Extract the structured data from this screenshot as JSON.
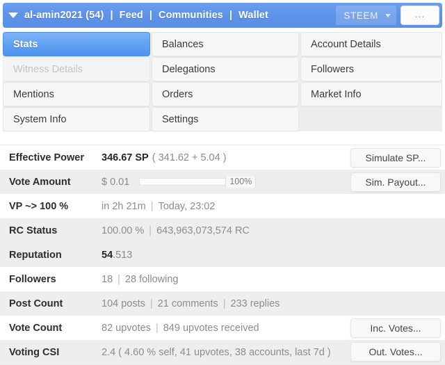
{
  "header": {
    "caret_icon": "caret-down-icon",
    "username": "al-amin2021 (54)",
    "links": [
      {
        "label": "Feed"
      },
      {
        "label": "Communities"
      },
      {
        "label": "Wallet"
      }
    ],
    "separator": "|",
    "token_selector": {
      "label": "STEEM",
      "caret_icon": "caret-down-icon"
    },
    "more_button": "...",
    "accent_color": "#5d92e8"
  },
  "tabs": [
    {
      "label": "Stats",
      "state": "active"
    },
    {
      "label": "Balances",
      "state": "normal"
    },
    {
      "label": "Account Details",
      "state": "normal"
    },
    {
      "label": "Witness Details",
      "state": "disabled"
    },
    {
      "label": "Delegations",
      "state": "normal"
    },
    {
      "label": "Followers",
      "state": "normal"
    },
    {
      "label": "Mentions",
      "state": "normal"
    },
    {
      "label": "Orders",
      "state": "normal"
    },
    {
      "label": "Market Info",
      "state": "normal"
    },
    {
      "label": "System Info",
      "state": "normal"
    },
    {
      "label": "Settings",
      "state": "normal"
    },
    {
      "label": "",
      "state": "empty"
    }
  ],
  "stats": {
    "effective_power": {
      "label": "Effective Power",
      "value_strong": "346.67 SP",
      "value_detail": "( 341.62 + 5.04 )",
      "action": "Simulate SP..."
    },
    "vote_amount": {
      "label": "Vote Amount",
      "value": "$ 0.01",
      "slider_value": "100%",
      "slider_percent": 100,
      "action": "Sim. Payout..."
    },
    "vp_to_100": {
      "label": "VP ~> 100 %",
      "remaining": "in 2h 21m",
      "separator": "|",
      "timestamp": "Today, 23:02"
    },
    "rc_status": {
      "label": "RC Status",
      "percent": "100.00 %",
      "separator": "|",
      "amount": "643,963,073,574 RC"
    },
    "reputation": {
      "label": "Reputation",
      "value_strong": "54",
      "value_detail": ".513"
    },
    "followers": {
      "label": "Followers",
      "count": "18",
      "separator": "|",
      "following": "28 following"
    },
    "post_count": {
      "label": "Post Count",
      "posts": "104 posts",
      "separator1": "|",
      "comments": "21 comments",
      "separator2": "|",
      "replies": "233 replies"
    },
    "vote_count": {
      "label": "Vote Count",
      "upvotes": "82 upvotes",
      "separator": "|",
      "received": "849 upvotes received",
      "action": "Inc. Votes..."
    },
    "voting_csi": {
      "label": "Voting CSI",
      "value": "2.4 ( 4.60 % self, 41 upvotes, 38 accounts, last 7d )",
      "action": "Out. Votes..."
    }
  }
}
